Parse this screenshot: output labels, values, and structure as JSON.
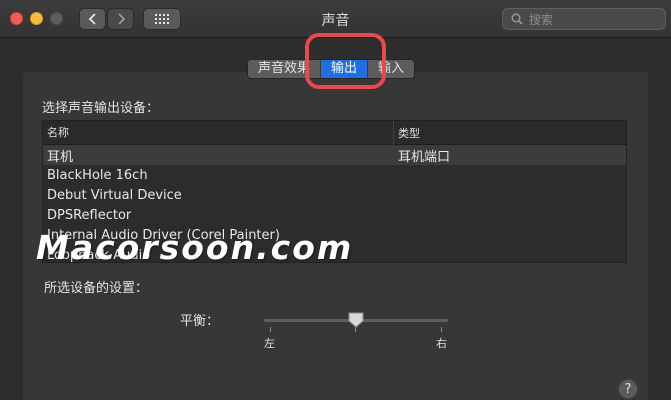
{
  "window": {
    "title": "声音"
  },
  "search": {
    "placeholder": "搜索"
  },
  "tabs": [
    {
      "label": "声音效果",
      "active": false
    },
    {
      "label": "输出",
      "active": true
    },
    {
      "label": "输入",
      "active": false
    }
  ],
  "output": {
    "heading": "选择声音输出设备：",
    "columns": {
      "name": "名称",
      "type": "类型"
    },
    "devices": [
      {
        "name": "耳机",
        "type": "耳机端口",
        "selected": true
      },
      {
        "name": "BlackHole 16ch",
        "type": ""
      },
      {
        "name": "Debut Virtual Device",
        "type": ""
      },
      {
        "name": "DPSReflector",
        "type": ""
      },
      {
        "name": "Internal Audio Driver (Corel Painter)",
        "type": ""
      },
      {
        "name": "Loopback Audio",
        "type": ""
      }
    ]
  },
  "settings": {
    "heading": "所选设备的设置：",
    "balance_label": "平衡：",
    "left_label": "左",
    "right_label": "右",
    "balance_value": 0.5
  },
  "watermark": "Macorsoon.com",
  "help": "?",
  "colors": {
    "accent": "#1f6fe0",
    "highlight_ring": "#e8494b"
  }
}
